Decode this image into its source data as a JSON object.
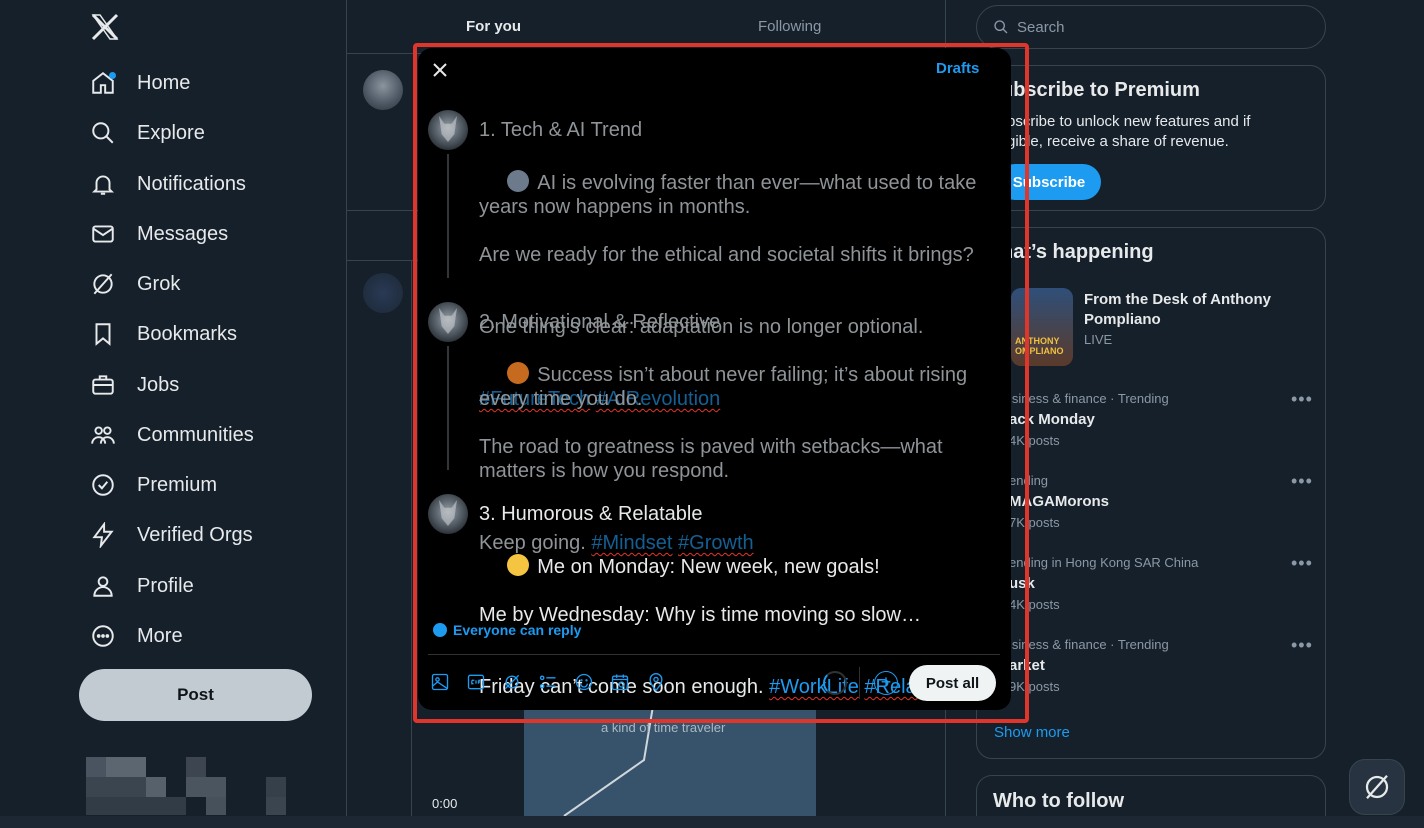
{
  "nav": {
    "items": [
      {
        "label": "Home",
        "icon": "home-icon"
      },
      {
        "label": "Explore",
        "icon": "search-icon"
      },
      {
        "label": "Notifications",
        "icon": "bell-icon"
      },
      {
        "label": "Messages",
        "icon": "envelope-icon"
      },
      {
        "label": "Grok",
        "icon": "grok-icon"
      },
      {
        "label": "Bookmarks",
        "icon": "bookmark-icon"
      },
      {
        "label": "Jobs",
        "icon": "briefcase-icon"
      },
      {
        "label": "Communities",
        "icon": "people-icon"
      },
      {
        "label": "Premium",
        "icon": "verified-badge-icon"
      },
      {
        "label": "Verified Orgs",
        "icon": "lightning-icon"
      },
      {
        "label": "Profile",
        "icon": "person-icon"
      },
      {
        "label": "More",
        "icon": "more-circle-icon"
      }
    ],
    "post_button": "Post"
  },
  "feed": {
    "tabs": [
      "For you",
      "Following"
    ],
    "video_caption": "a kind of time traveler",
    "video_time": "0:00"
  },
  "composer": {
    "drafts_label": "Drafts",
    "posts": [
      {
        "title": "1. Tech & AI Trend",
        "emoji": "robot",
        "line1": "AI is evolving faster than ever—what used to take years now happens in months.",
        "line2": "Are we ready for the ethical and societal shifts it brings?",
        "line3": "One thing’s clear: adaptation is no longer optional.",
        "tags": [
          "#FutureTech",
          "#AIRevolution"
        ]
      },
      {
        "title": "2. Motivational & Reflective",
        "emoji": "fire",
        "line1": "Success isn’t about never failing; it’s about rising every time you do.",
        "line2": "The road to greatness is paved with setbacks—what matters is how you respond.",
        "line3": "Keep going.",
        "tags": [
          "#Mindset",
          "#Growth"
        ]
      },
      {
        "title": "3. Humorous & Relatable",
        "emoji": "grinning-squinting-face",
        "line1": "Me on Monday: New week, new goals!",
        "line2": "Me by Wednesday: Why is time moving so slow…",
        "line3": "Friday can’t come soon enough.",
        "tags": [
          "#WorkLife",
          "#Relatable"
        ]
      }
    ],
    "reply_setting": "Everyone can reply",
    "post_all_label": "Post all",
    "add_label": "+"
  },
  "sidebar": {
    "search_placeholder": "Search",
    "premium": {
      "title": "ubscribe to Premium",
      "text1": "bscribe to unlock new features and if",
      "text2": "gible, receive a share of revenue.",
      "button": "Subscribe"
    },
    "happening": {
      "title": "hat’s happening",
      "featured_title1": "From the Desk of Anthony",
      "featured_title2": "Pompliano",
      "featured_status": "LIVE",
      "featured_thumb_text1": "ANTHONY",
      "featured_thumb_text2": "OMPLIANO",
      "trends": [
        {
          "meta": "isiness & finance · Trending",
          "title": "ack Monday",
          "count": "4K posts"
        },
        {
          "meta": "ending",
          "title": "MAGAMorons",
          "count": "7K posts"
        },
        {
          "meta": "ending in Hong Kong SAR China",
          "title": "usk",
          "count": "4K posts"
        },
        {
          "meta": "isiness & finance · Trending",
          "title": "arket",
          "count": "9K posts"
        }
      ],
      "show_more": "Show more"
    },
    "who_to_follow": "Who to follow"
  },
  "colors": {
    "accent": "#1d9bf0",
    "background": "#15202b",
    "highlight": "#e0352b"
  }
}
